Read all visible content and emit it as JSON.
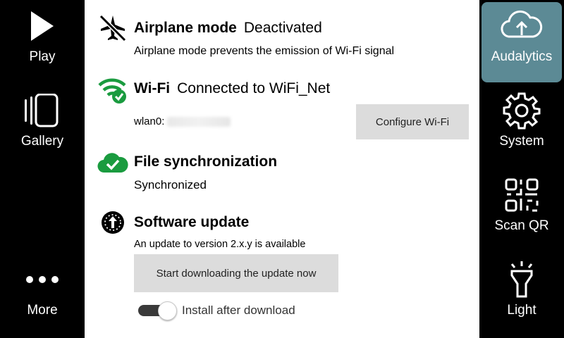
{
  "left_nav": {
    "play": "Play",
    "gallery": "Gallery",
    "more": "More"
  },
  "right_nav": {
    "audalytics": "Audalytics",
    "system": "System",
    "scan_qr": "Scan QR",
    "light": "Light"
  },
  "airplane": {
    "title": "Airplane mode",
    "status": "Deactivated",
    "description": "Airplane mode prevents the emission of Wi-Fi signal",
    "icon": "airplane-off-icon"
  },
  "wifi": {
    "title": "Wi-Fi",
    "status": "Connected to WiFi_Net",
    "interface_label": "wlan0:",
    "configure_label": "Configure Wi-Fi",
    "icon": "wifi-check-icon"
  },
  "sync": {
    "title": "File synchronization",
    "status": "Synchronized",
    "icon": "cloud-check-icon"
  },
  "update": {
    "title": "Software update",
    "description": "An update to version 2.x.y is available",
    "download_label": "Start downloading the update now",
    "install_toggle_label": "Install after download",
    "install_toggle_on": true,
    "icon": "update-icon"
  },
  "colors": {
    "active_nav": "#5c8a95",
    "success_green": "#1a9b3f",
    "button_gray": "#dcdcdc"
  }
}
